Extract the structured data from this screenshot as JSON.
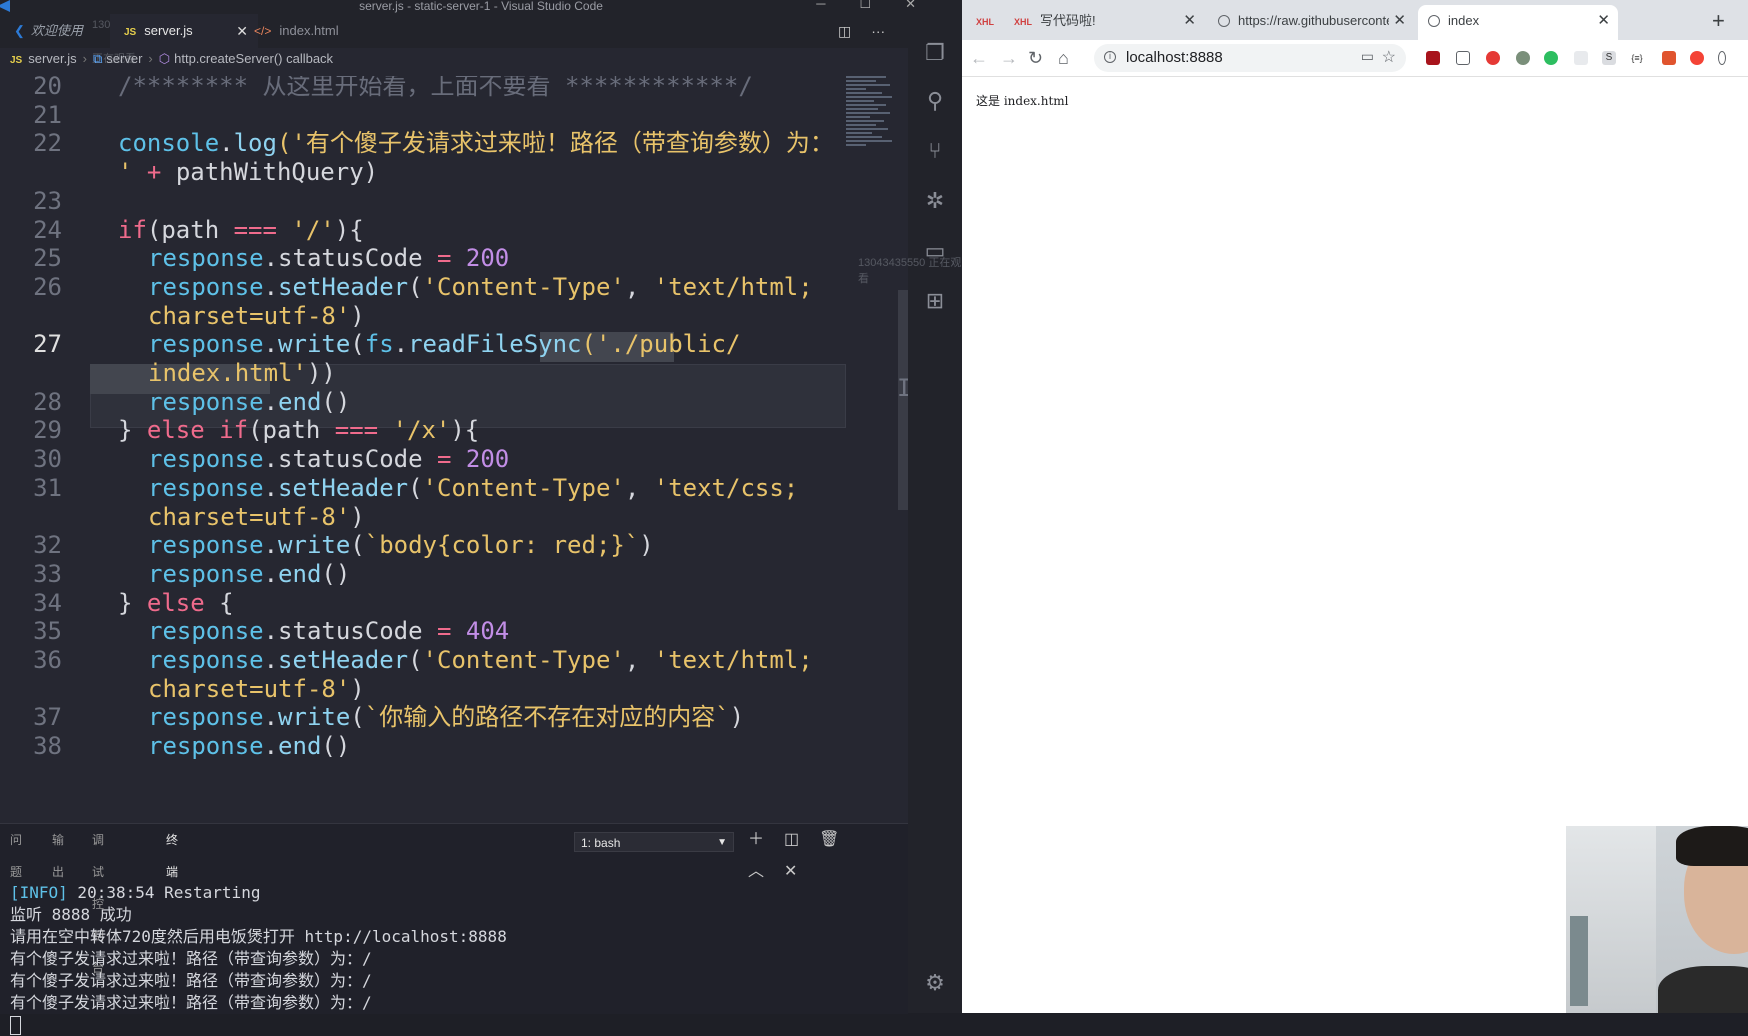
{
  "vscode": {
    "window_title": "server.js - static-server-1 - Visual Studio Code",
    "tabs": [
      {
        "label": "欢迎使用"
      },
      {
        "label": "server.js"
      },
      {
        "label": "index.html"
      }
    ],
    "watermark": "13043435550 正在观看",
    "breadcrumb": [
      "server.js",
      "server",
      "http.createServer() callback"
    ],
    "active_line": 27,
    "code_lines": [
      {
        "ln": "20",
        "tokens": [
          {
            "t": "/******** 从这里开始看，上面不要看 ************/",
            "c": "com"
          }
        ]
      },
      {
        "ln": "21",
        "tokens": []
      },
      {
        "ln": "22",
        "tokens": [
          {
            "t": "console",
            "c": "obj"
          },
          {
            "t": ".",
            "c": "id"
          },
          {
            "t": "log",
            "c": "fn"
          },
          {
            "t": "('有个傻子发请求过来啦！路径（带查询参数）为：",
            "c": "str"
          }
        ]
      },
      {
        "ln": "",
        "tokens": [
          {
            "t": "' ",
            "c": "str"
          },
          {
            "t": "+ ",
            "c": "op"
          },
          {
            "t": "pathWithQuery)",
            "c": "id"
          }
        ]
      },
      {
        "ln": "23",
        "tokens": []
      },
      {
        "ln": "24",
        "tokens": [
          {
            "t": "if",
            "c": "kw"
          },
          {
            "t": "(path ",
            "c": "id"
          },
          {
            "t": "=== ",
            "c": "op"
          },
          {
            "t": "'/'",
            "c": "str"
          },
          {
            "t": "){",
            "c": "id"
          }
        ]
      },
      {
        "ln": "25",
        "indent": true,
        "tokens": [
          {
            "t": "response",
            "c": "obj"
          },
          {
            "t": ".statusCode ",
            "c": "id"
          },
          {
            "t": "= ",
            "c": "op"
          },
          {
            "t": "200",
            "c": "num"
          }
        ]
      },
      {
        "ln": "26",
        "indent": true,
        "tokens": [
          {
            "t": "response",
            "c": "obj"
          },
          {
            "t": ".",
            "c": "id"
          },
          {
            "t": "setHeader",
            "c": "fn"
          },
          {
            "t": "(",
            "c": "id"
          },
          {
            "t": "'Content-Type'",
            "c": "str"
          },
          {
            "t": ", ",
            "c": "id"
          },
          {
            "t": "'text/html;",
            "c": "str"
          }
        ]
      },
      {
        "ln": "",
        "indent": true,
        "tokens": [
          {
            "t": "charset=utf-8'",
            "c": "str"
          },
          {
            "t": ")",
            "c": "id"
          }
        ]
      },
      {
        "ln": "27",
        "indent": true,
        "tokens": [
          {
            "t": "response",
            "c": "obj"
          },
          {
            "t": ".",
            "c": "id"
          },
          {
            "t": "write",
            "c": "fn"
          },
          {
            "t": "(",
            "c": "id"
          },
          {
            "t": "fs",
            "c": "obj"
          },
          {
            "t": ".",
            "c": "id"
          },
          {
            "t": "readFileSync",
            "c": "fn"
          },
          {
            "t": "('./public/",
            "c": "str"
          }
        ]
      },
      {
        "ln": "",
        "indent": true,
        "tokens": [
          {
            "t": "index.html'",
            "c": "str"
          },
          {
            "t": "))",
            "c": "id"
          }
        ]
      },
      {
        "ln": "28",
        "indent": true,
        "tokens": [
          {
            "t": "response",
            "c": "obj"
          },
          {
            "t": ".",
            "c": "id"
          },
          {
            "t": "end",
            "c": "fn"
          },
          {
            "t": "()",
            "c": "id"
          }
        ]
      },
      {
        "ln": "29",
        "tokens": [
          {
            "t": "} ",
            "c": "id"
          },
          {
            "t": "else if",
            "c": "kw"
          },
          {
            "t": "(path ",
            "c": "id"
          },
          {
            "t": "=== ",
            "c": "op"
          },
          {
            "t": "'/x'",
            "c": "str"
          },
          {
            "t": "){",
            "c": "id"
          }
        ]
      },
      {
        "ln": "30",
        "indent": true,
        "tokens": [
          {
            "t": "response",
            "c": "obj"
          },
          {
            "t": ".statusCode ",
            "c": "id"
          },
          {
            "t": "= ",
            "c": "op"
          },
          {
            "t": "200",
            "c": "num"
          }
        ]
      },
      {
        "ln": "31",
        "indent": true,
        "tokens": [
          {
            "t": "response",
            "c": "obj"
          },
          {
            "t": ".",
            "c": "id"
          },
          {
            "t": "setHeader",
            "c": "fn"
          },
          {
            "t": "(",
            "c": "id"
          },
          {
            "t": "'Content-Type'",
            "c": "str"
          },
          {
            "t": ", ",
            "c": "id"
          },
          {
            "t": "'text/css;",
            "c": "str"
          }
        ]
      },
      {
        "ln": "",
        "indent": true,
        "tokens": [
          {
            "t": "charset=utf-8'",
            "c": "str"
          },
          {
            "t": ")",
            "c": "id"
          }
        ]
      },
      {
        "ln": "32",
        "indent": true,
        "tokens": [
          {
            "t": "response",
            "c": "obj"
          },
          {
            "t": ".",
            "c": "id"
          },
          {
            "t": "write",
            "c": "fn"
          },
          {
            "t": "(",
            "c": "id"
          },
          {
            "t": "`body{color: red;}`",
            "c": "str"
          },
          {
            "t": ")",
            "c": "id"
          }
        ]
      },
      {
        "ln": "33",
        "indent": true,
        "tokens": [
          {
            "t": "response",
            "c": "obj"
          },
          {
            "t": ".",
            "c": "id"
          },
          {
            "t": "end",
            "c": "fn"
          },
          {
            "t": "()",
            "c": "id"
          }
        ]
      },
      {
        "ln": "34",
        "tokens": [
          {
            "t": "} ",
            "c": "id"
          },
          {
            "t": "else ",
            "c": "kw"
          },
          {
            "t": "{",
            "c": "id"
          }
        ]
      },
      {
        "ln": "35",
        "indent": true,
        "tokens": [
          {
            "t": "response",
            "c": "obj"
          },
          {
            "t": ".statusCode ",
            "c": "id"
          },
          {
            "t": "= ",
            "c": "op"
          },
          {
            "t": "404",
            "c": "num"
          }
        ]
      },
      {
        "ln": "36",
        "indent": true,
        "tokens": [
          {
            "t": "response",
            "c": "obj"
          },
          {
            "t": ".",
            "c": "id"
          },
          {
            "t": "setHeader",
            "c": "fn"
          },
          {
            "t": "(",
            "c": "id"
          },
          {
            "t": "'Content-Type'",
            "c": "str"
          },
          {
            "t": ", ",
            "c": "id"
          },
          {
            "t": "'text/html;",
            "c": "str"
          }
        ]
      },
      {
        "ln": "",
        "indent": true,
        "tokens": [
          {
            "t": "charset=utf-8'",
            "c": "str"
          },
          {
            "t": ")",
            "c": "id"
          }
        ]
      },
      {
        "ln": "37",
        "indent": true,
        "tokens": [
          {
            "t": "response",
            "c": "obj"
          },
          {
            "t": ".",
            "c": "id"
          },
          {
            "t": "write",
            "c": "fn"
          },
          {
            "t": "(",
            "c": "id"
          },
          {
            "t": "`你输入的路径不存在对应的内容`",
            "c": "str"
          },
          {
            "t": ")",
            "c": "id"
          }
        ]
      },
      {
        "ln": "38",
        "indent": true,
        "tokens": [
          {
            "t": "response",
            "c": "obj"
          },
          {
            "t": ".",
            "c": "id"
          },
          {
            "t": "end",
            "c": "fn"
          },
          {
            "t": "()",
            "c": "id"
          }
        ]
      }
    ],
    "panel": {
      "tabs": [
        "问题",
        "输出",
        "调试控制台",
        "终端"
      ],
      "active_tab": "终端",
      "terminal_select": "1: bash",
      "terminal_lines": [
        "[INFO] 20:38:54 Restarting",
        "监听 8888 成功",
        "请用在空中转体720度然后用电饭煲打开 http://localhost:8888",
        "有个傻子发请求过来啦！路径（带查询参数）为：/",
        "有个傻子发请求过来啦！路径（带查询参数）为：/",
        "有个傻子发请求过来啦！路径（带查询参数）为：/"
      ]
    }
  },
  "chrome": {
    "tabs": [
      {
        "label": "",
        "favicon": "XHL"
      },
      {
        "label": "写代码啦!",
        "favicon": "XHL"
      },
      {
        "label": "https://raw.githubusercontent",
        "favicon": "globe-icon"
      },
      {
        "label": "index",
        "favicon": "globe-icon"
      }
    ],
    "url": "localhost:8888",
    "page_text": "这是 index.html"
  },
  "colors": {
    "editor_bg": "#262731",
    "string": "#e8c36a",
    "keyword": "#ef6b8c",
    "object": "#5ec1e8",
    "number": "#c28ee6"
  }
}
